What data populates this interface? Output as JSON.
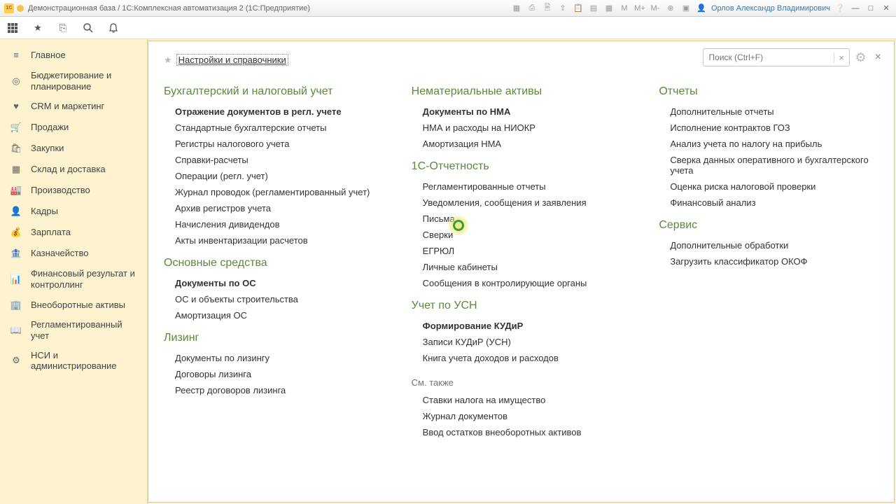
{
  "titlebar": {
    "logo_text": "1C",
    "title": "Демонстрационная база / 1С:Комплексная автоматизация 2  (1С:Предприятие)",
    "user": "Орлов Александр Владимирович",
    "m_labels": [
      "M",
      "M+",
      "M-"
    ]
  },
  "search": {
    "placeholder": "Поиск (Ctrl+F)"
  },
  "sidebar": [
    "Главное",
    "Бюджетирование и планирование",
    "CRM и маркетинг",
    "Продажи",
    "Закупки",
    "Склад и доставка",
    "Производство",
    "Кадры",
    "Зарплата",
    "Казначейство",
    "Финансовый результат и контроллинг",
    "Внеоборотные активы",
    "Регламентированный учет",
    "НСИ и администрирование"
  ],
  "favorite": "Настройки и справочники",
  "col1": {
    "g1": {
      "title": "Бухгалтерский и налоговый учет",
      "items": [
        {
          "t": "Отражение документов в регл. учете",
          "b": true
        },
        {
          "t": "Стандартные бухгалтерские отчеты"
        },
        {
          "t": "Регистры налогового учета"
        },
        {
          "t": "Справки-расчеты"
        },
        {
          "t": "Операции (регл. учет)"
        },
        {
          "t": "Журнал проводок (регламентированный учет)"
        },
        {
          "t": "Архив регистров учета"
        },
        {
          "t": "Начисления дивидендов"
        },
        {
          "t": "Акты инвентаризации расчетов"
        }
      ]
    },
    "g2": {
      "title": "Основные средства",
      "items": [
        {
          "t": "Документы по ОС",
          "b": true
        },
        {
          "t": "ОС и объекты строительства"
        },
        {
          "t": "Амортизация ОС"
        }
      ]
    },
    "g3": {
      "title": "Лизинг",
      "items": [
        {
          "t": "Документы по лизингу"
        },
        {
          "t": "Договоры лизинга"
        },
        {
          "t": "Реестр договоров лизинга"
        }
      ]
    }
  },
  "col2": {
    "g1": {
      "title": "Нематериальные активы",
      "items": [
        {
          "t": "Документы по НМА",
          "b": true
        },
        {
          "t": "НМА и расходы на НИОКР"
        },
        {
          "t": "Амортизация НМА"
        }
      ]
    },
    "g2": {
      "title": "1С-Отчетность",
      "items": [
        {
          "t": "Регламентированные отчеты"
        },
        {
          "t": "Уведомления, сообщения и заявления"
        },
        {
          "t": "Письма"
        },
        {
          "t": "Сверки"
        },
        {
          "t": "ЕГРЮЛ"
        },
        {
          "t": "Личные кабинеты"
        },
        {
          "t": "Сообщения в контролирующие органы"
        }
      ]
    },
    "g3": {
      "title": "Учет по УСН",
      "items": [
        {
          "t": "Формирование КУДиР",
          "b": true
        },
        {
          "t": "Записи КУДиР (УСН)"
        },
        {
          "t": "Книга учета доходов и расходов"
        }
      ]
    },
    "g4": {
      "title": "См. также",
      "sub": true,
      "items": [
        {
          "t": "Ставки налога на имущество"
        },
        {
          "t": "Журнал документов"
        },
        {
          "t": "Ввод остатков внеоборотных активов"
        }
      ]
    }
  },
  "col3": {
    "g1": {
      "title": "Отчеты",
      "items": [
        {
          "t": "Дополнительные отчеты"
        },
        {
          "t": "Исполнение контрактов ГОЗ"
        },
        {
          "t": "Анализ учета по налогу на прибыль"
        },
        {
          "t": "Сверка данных оперативного и бухгалтерского учета"
        },
        {
          "t": "Оценка риска налоговой проверки"
        },
        {
          "t": "Финансовый анализ"
        }
      ]
    },
    "g2": {
      "title": "Сервис",
      "items": [
        {
          "t": "Дополнительные обработки"
        },
        {
          "t": "Загрузить классификатор ОКОФ"
        }
      ]
    }
  }
}
